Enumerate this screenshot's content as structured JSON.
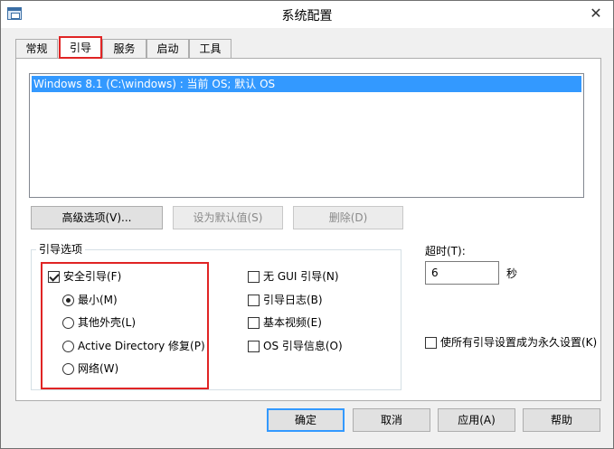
{
  "window": {
    "title": "系统配置",
    "close_glyph": "✕"
  },
  "tabs": [
    {
      "label": "常规",
      "active": false
    },
    {
      "label": "引导",
      "active": true
    },
    {
      "label": "服务",
      "active": false
    },
    {
      "label": "启动",
      "active": false
    },
    {
      "label": "工具",
      "active": false
    }
  ],
  "boot": {
    "os_entries": [
      "Windows 8.1 (C:\\windows) : 当前 OS; 默认 OS"
    ],
    "buttons": {
      "advanced": "高级选项(V)...",
      "set_default": "设为默认值(S)",
      "delete": "删除(D)"
    },
    "options_group_label": "引导选项",
    "safe_boot": {
      "label": "安全引导(F)",
      "checked": true
    },
    "safe_modes": [
      {
        "label": "最小(M)",
        "checked": true
      },
      {
        "label": "其他外壳(L)",
        "checked": false
      },
      {
        "label": "Active Directory 修复(P)",
        "checked": false
      },
      {
        "label": "网络(W)",
        "checked": false
      }
    ],
    "right_options": [
      {
        "label": "无 GUI 引导(N)",
        "checked": false
      },
      {
        "label": "引导日志(B)",
        "checked": false
      },
      {
        "label": "基本视频(E)",
        "checked": false
      },
      {
        "label": "OS 引导信息(O)",
        "checked": false
      }
    ],
    "timeout": {
      "label": "超时(T):",
      "value": "6",
      "unit": "秒"
    },
    "permanent": {
      "label": "使所有引导设置成为永久设置(K)",
      "checked": false
    }
  },
  "footer": {
    "ok": "确定",
    "cancel": "取消",
    "apply": "应用(A)",
    "help": "帮助"
  },
  "colors": {
    "selection": "#3399ff",
    "annotation": "#e02424"
  }
}
